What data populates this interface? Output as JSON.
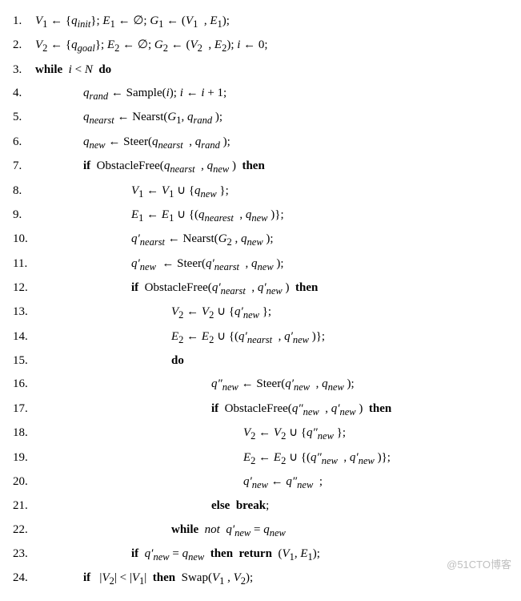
{
  "algorithm": {
    "lines": [
      {
        "n": "1.",
        "indent": "",
        "html": "<i>V</i><sub>1</sub> ← {<i>q<sub>init</sub></i>}; <i>E</i><sub>1</sub> ← ∅; <i>G</i><sub>1</sub> ← (<i>V</i><sub>1</sub>&nbsp;&nbsp;, <i>E</i><sub>1</sub>);"
      },
      {
        "n": "2.",
        "indent": "",
        "html": "<i>V</i><sub>2</sub> ← {<i>q<sub>goal</sub></i>}; <i>E</i><sub>2</sub> ← ∅; <i>G</i><sub>2</sub> ← (<i>V</i><sub>2</sub>&nbsp;&nbsp;, <i>E</i><sub>2</sub>); <i>i</i> ← 0;"
      },
      {
        "n": "3.",
        "indent": "",
        "html": "<span class='kw'>while</span>&nbsp;&nbsp;<i>i</i> &lt; <i>N</i>&nbsp;&nbsp;<span class='kw'>do</span>"
      },
      {
        "n": "4.",
        "indent": "i1",
        "html": "<i>q<sub>rand</sub></i> ← Sample(<i>i</i>); <i>i</i> ← <i>i</i> + 1;"
      },
      {
        "n": "5.",
        "indent": "i1",
        "html": "<i>q<sub>nearst</sub></i> ← Nearst(<i>G</i><sub>1</sub>, <i>q<sub>rand</sub></i>&nbsp;);"
      },
      {
        "n": "6.",
        "indent": "i1",
        "html": "<i>q<sub>new</sub></i> ← Steer(<i>q<sub>nearst</sub></i>&nbsp;&nbsp;, <i>q<sub>rand</sub></i>&nbsp;);"
      },
      {
        "n": "7.",
        "indent": "i1",
        "html": "<span class='kw'>if</span>&nbsp;&nbsp;ObstacleFree(<i>q<sub>nearst</sub></i>&nbsp;&nbsp;, <i>q<sub>new</sub></i>&nbsp;)&nbsp;&nbsp;<span class='kw'>then</span>"
      },
      {
        "n": "8.",
        "indent": "i2",
        "html": "<i>V</i><sub>1</sub> ← <i>V</i><sub>1</sub> ∪ {<i>q<sub>new</sub></i>&nbsp;};"
      },
      {
        "n": "9.",
        "indent": "i2",
        "html": "<i>E</i><sub>1</sub> ← <i>E</i><sub>1</sub> ∪ {(<i>q<sub>nearest</sub></i>&nbsp;&nbsp;, <i>q<sub>new</sub></i>&nbsp;)};"
      },
      {
        "n": "10.",
        "indent": "i2",
        "html": "<i>q′<sub>nearst</sub></i> ← Nearst(<i>G</i><sub>2</sub>&nbsp;, <i>q<sub>new</sub></i>&nbsp;);"
      },
      {
        "n": "11.",
        "indent": "i2",
        "html": "<i>q′<sub>new</sub></i>&nbsp;&nbsp;← Steer(<i>q′<sub>nearst</sub></i>&nbsp;&nbsp;, <i>q<sub>new</sub></i>&nbsp;);"
      },
      {
        "n": "12.",
        "indent": "i2",
        "html": "<span class='kw'>if</span>&nbsp;&nbsp;ObstacleFree(<i>q′<sub>nearst</sub></i>&nbsp;&nbsp;, <i>q′<sub>new</sub></i>&nbsp;)&nbsp;&nbsp;<span class='kw'>then</span>"
      },
      {
        "n": "13.",
        "indent": "i3",
        "html": "<i>V</i><sub>2</sub> ← <i>V</i><sub>2</sub> ∪ {<i>q′<sub>new</sub></i>&nbsp;};"
      },
      {
        "n": "14.",
        "indent": "i3",
        "html": "<i>E</i><sub>2</sub> ← <i>E</i><sub>2</sub> ∪ {(<i>q′<sub>nearst</sub></i>&nbsp;&nbsp;, <i>q′<sub>new</sub></i>&nbsp;)};"
      },
      {
        "n": "15.",
        "indent": "i3",
        "html": "<span class='kw'>do</span>"
      },
      {
        "n": "16.",
        "indent": "i4",
        "html": "<i>q″<sub>new</sub></i> ← Steer(<i>q′<sub>new</sub></i>&nbsp;&nbsp;, <i>q<sub>new</sub></i>&nbsp;);"
      },
      {
        "n": "17.",
        "indent": "i4",
        "html": "<span class='kw'>if</span>&nbsp;&nbsp;ObstacleFree(<i>q″<sub>new</sub></i>&nbsp;&nbsp;, <i>q′<sub>new</sub></i>&nbsp;)&nbsp;&nbsp;<span class='kw'>then</span>"
      },
      {
        "n": "18.",
        "indent": "i5",
        "html": "<i>V</i><sub>2</sub> ← <i>V</i><sub>2</sub> ∪ {<i>q″<sub>new</sub></i>&nbsp;};"
      },
      {
        "n": "19.",
        "indent": "i5",
        "html": "<i>E</i><sub>2</sub> ← <i>E</i><sub>2</sub> ∪ {(<i>q″<sub>new</sub></i>&nbsp;&nbsp;, <i>q′<sub>new</sub></i>&nbsp;)};"
      },
      {
        "n": "20.",
        "indent": "i5",
        "html": "<i>q′<sub>new</sub></i> ← <i>q″<sub>new</sub></i>&nbsp;&nbsp;;"
      },
      {
        "n": "21.",
        "indent": "i4",
        "html": "<span class='kw'>else&nbsp;&nbsp;break</span>;"
      },
      {
        "n": "22.",
        "indent": "i3",
        "html": "<span class='kw'>while</span>&nbsp;&nbsp;<i>not</i>&nbsp;&nbsp;<i>q′<sub>new</sub></i> = <i>q<sub>new</sub></i>"
      },
      {
        "n": "23.",
        "indent": "i2",
        "html": "<span class='kw'>if</span>&nbsp;&nbsp;<i>q′<sub>new</sub></i> = <i>q<sub>new</sub></i>&nbsp;&nbsp;<span class='kw'>then&nbsp;&nbsp;return</span>&nbsp;&nbsp;(<i>V</i><sub>1</sub>, <i>E</i><sub>1</sub>);"
      },
      {
        "n": "24.",
        "indent": "i1",
        "html": "<span class='kw'>if</span>&nbsp;&nbsp;&nbsp;|<i>V</i><sub>2</sub>| &lt; |<i>V</i><sub>1</sub>|&nbsp;&nbsp;<span class='kw'>then</span>&nbsp;&nbsp;Swap(<i>V</i><sub>1</sub>&nbsp;, <i>V</i><sub>2</sub>);"
      }
    ]
  },
  "watermark": "@51CTO博客"
}
